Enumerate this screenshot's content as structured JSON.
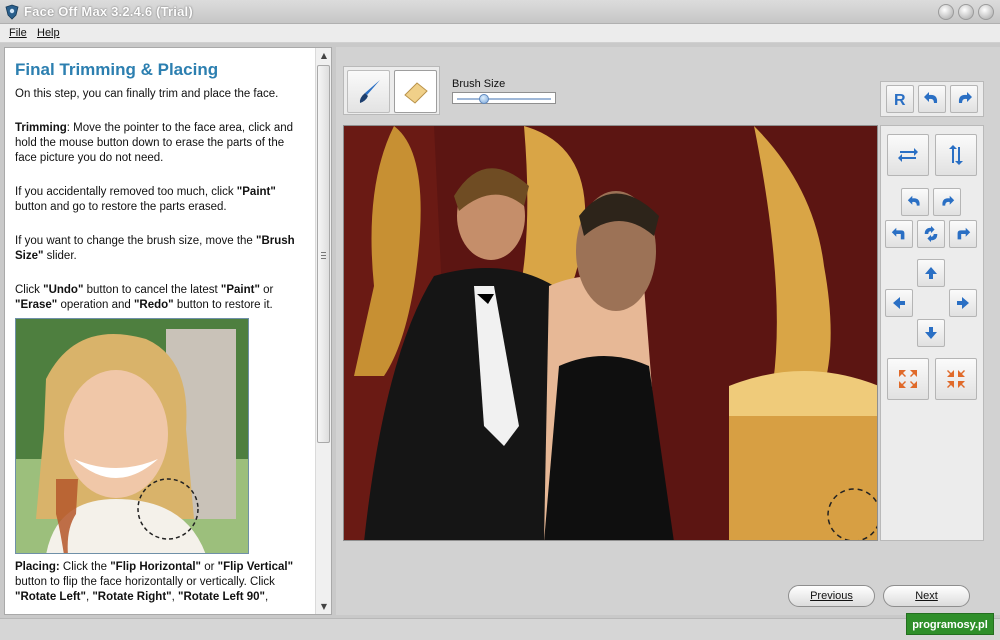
{
  "window": {
    "title": "Face Off Max  3.2.4.6  (Trial)",
    "controls": [
      "minimize-icon",
      "maximize-icon",
      "close-icon"
    ]
  },
  "menu": {
    "items": [
      "File",
      "Help"
    ]
  },
  "instructions": {
    "heading": "Final Trimming & Placing",
    "intro": "On this step, you can finally trim and place the face.",
    "trimming_label": "Trimming",
    "trimming_text": ": Move the pointer to the face area, click and hold the mouse button down to erase the parts of the face picture you do not need.",
    "accident_text_1": "If you accidentally removed too much, click ",
    "paint_label": "\"Paint\"",
    "accident_text_2": " button and go to restore the parts erased.",
    "brush_text_1": "If you want to change the brush size, move the ",
    "brush_label": "\"Brush Size\"",
    "brush_text_2": " slider.",
    "undo_text_1": "Click ",
    "undo_label": "\"Undo\"",
    "undo_text_2": " button to cancel the latest ",
    "paint_label_2": "\"Paint\"",
    "undo_text_3": " or ",
    "erase_label": "\"Erase\"",
    "undo_text_4": " operation and ",
    "redo_label": "\"Redo\"",
    "undo_text_5": " button to restore it.",
    "placing_label": "Placing:",
    "placing_text_1": " Click the ",
    "flip_h_label": "\"Flip Horizontal\"",
    "placing_text_2": " or ",
    "flip_v_label": "\"Flip Vertical\"",
    "placing_text_3": " button to flip the face horizontally or vertically. Click ",
    "rotate_left_label": "\"Rotate Left\"",
    "placing_text_4": ", ",
    "rotate_right_label": "\"Rotate Right\"",
    "placing_text_5": ", ",
    "rotate_left_90_label": "\"Rotate Left 90\"",
    "placing_text_6": ","
  },
  "toolbar": {
    "paint_tool_icon": "brush-icon",
    "erase_tool_icon": "eraser-icon",
    "brush_size_label": "Brush Size",
    "brush_size_value": 0.28
  },
  "accent": {
    "heading_color": "#2c7fb0",
    "icon_blue": "#2a6fc4",
    "icon_orange": "#e06a2a",
    "watermark_green": "#2f8f2a"
  },
  "nav": {
    "previous": "Previous",
    "next": "Next"
  },
  "watermark": "programosy.pl"
}
